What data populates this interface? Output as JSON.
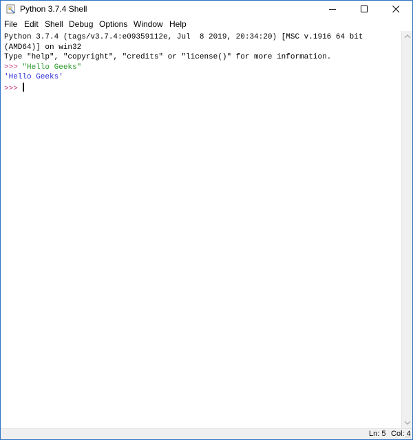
{
  "window": {
    "title": "Python 3.7.4 Shell",
    "app_icon": "python-idle-icon",
    "controls": {
      "minimize_icon": "minimize-icon",
      "maximize_icon": "maximize-icon",
      "close_icon": "close-icon"
    }
  },
  "menubar": {
    "items": [
      "File",
      "Edit",
      "Shell",
      "Debug",
      "Options",
      "Window",
      "Help"
    ]
  },
  "shell": {
    "banner_line_1": "Python 3.7.4 (tags/v3.7.4:e09359112e, Jul  8 2019, 20:34:20) [MSC v.1916 64 bit",
    "banner_line_2": "(AMD64)] on win32",
    "banner_line_3": "Type \"help\", \"copyright\", \"credits\" or \"license()\" for more information.",
    "prompt": ">>> ",
    "input_1": "\"Hello Geeks\"",
    "output_1": "'Hello Geeks'",
    "prompt_current": ">>> "
  },
  "statusbar": {
    "line": "Ln: 5",
    "column": "Col: 4"
  },
  "colors": {
    "prompt": "#c0327a",
    "string_input": "#2c9a2c",
    "string_output": "#2b2bd6",
    "window_border": "#2b73c2"
  }
}
